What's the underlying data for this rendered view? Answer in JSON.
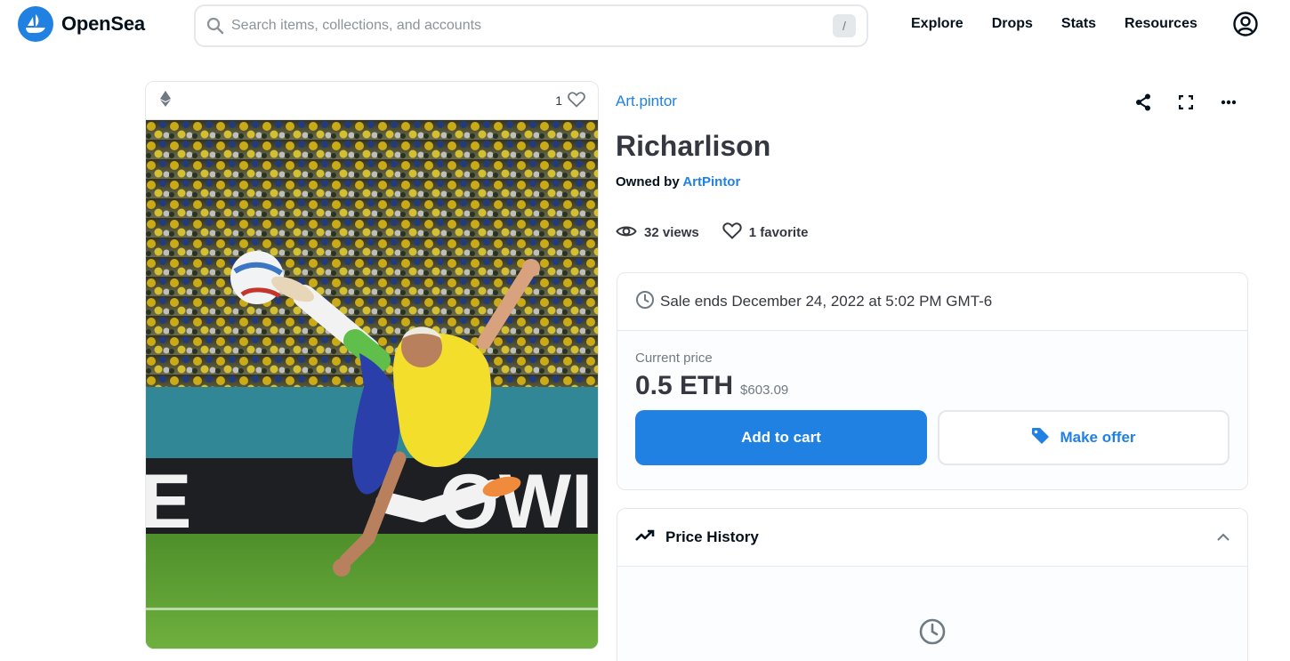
{
  "brand": {
    "name": "OpenSea",
    "accent": "#2081e2"
  },
  "search": {
    "placeholder": "Search items, collections, and accounts",
    "shortcut": "/"
  },
  "nav": {
    "items": [
      {
        "label": "Explore"
      },
      {
        "label": "Drops"
      },
      {
        "label": "Stats"
      },
      {
        "label": "Resources"
      }
    ]
  },
  "media": {
    "favorite_count": "1",
    "chain_icon": "ethereum-icon"
  },
  "item": {
    "collection": "Art.pintor",
    "title": "Richarlison",
    "owned_by_label": "Owned by",
    "owner": "ArtPintor",
    "views": "32 views",
    "favorites": "1 favorite"
  },
  "sale": {
    "ends_text": "Sale ends December 24, 2022 at 5:02 PM GMT-6",
    "current_price_label": "Current price",
    "price_eth": "0.5 ETH",
    "price_usd": "$603.09",
    "add_to_cart": "Add to cart",
    "make_offer": "Make offer"
  },
  "price_history": {
    "label": "Price History"
  }
}
